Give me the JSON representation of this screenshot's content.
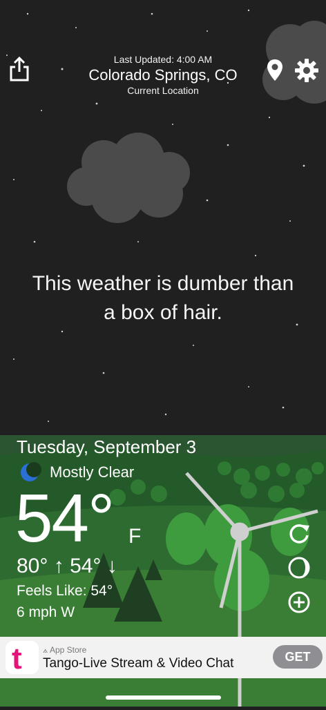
{
  "header": {
    "last_updated": "Last Updated: 4:00 AM",
    "city": "Colorado Springs, CO",
    "location_type": "Current Location"
  },
  "quip": {
    "line1": "This weather is dumber than",
    "line2": "a box of hair."
  },
  "conditions": {
    "date": "Tuesday, September 3",
    "condition": "Mostly Clear",
    "temperature": "54°",
    "unit": "F",
    "high": "80°",
    "low": "54°",
    "feels_like": "Feels Like: 54°",
    "wind": "6 mph W"
  },
  "ad": {
    "store_label": "App Store",
    "app_name": "Tango-Live Stream & Video Chat",
    "cta": "GET"
  },
  "icons": {
    "share": "share-icon",
    "location": "location-pin-icon",
    "settings": "gear-icon",
    "refresh": "refresh-icon",
    "moon": "moon-icon",
    "add": "plus-circle-icon"
  },
  "colors": {
    "sky": "#202020",
    "grass": "#2f6a32",
    "tree": "#3a8c3a",
    "ad_background": "#f2f2f2",
    "get_button": "#8e8e93",
    "brand_tango": "#e6137a"
  }
}
